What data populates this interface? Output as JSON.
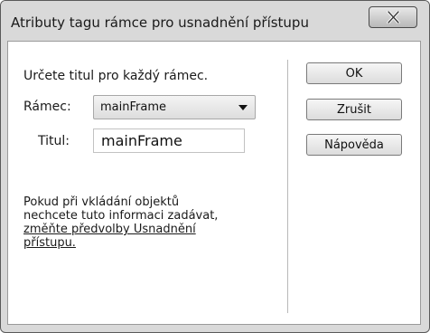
{
  "window": {
    "title": "Atributy tagu rámce pro usnadnění přístupu"
  },
  "form": {
    "instruction": "Určete titul pro každý rámec.",
    "frame_label": "Rámec:",
    "frame_selected": "mainFrame",
    "title_label": "Titul:",
    "title_value": "mainFrame"
  },
  "info": {
    "line1": "Pokud při vkládání objektů",
    "line2": "nechcete tuto informaci zadávat,",
    "link_line1": "změňte předvolby Usnadnění",
    "link_line2": "přístupu."
  },
  "buttons": {
    "ok": "OK",
    "cancel": "Zrušit",
    "help": "Nápověda"
  },
  "icons": {
    "close": "close-icon",
    "dropdown": "chevron-down-icon"
  }
}
